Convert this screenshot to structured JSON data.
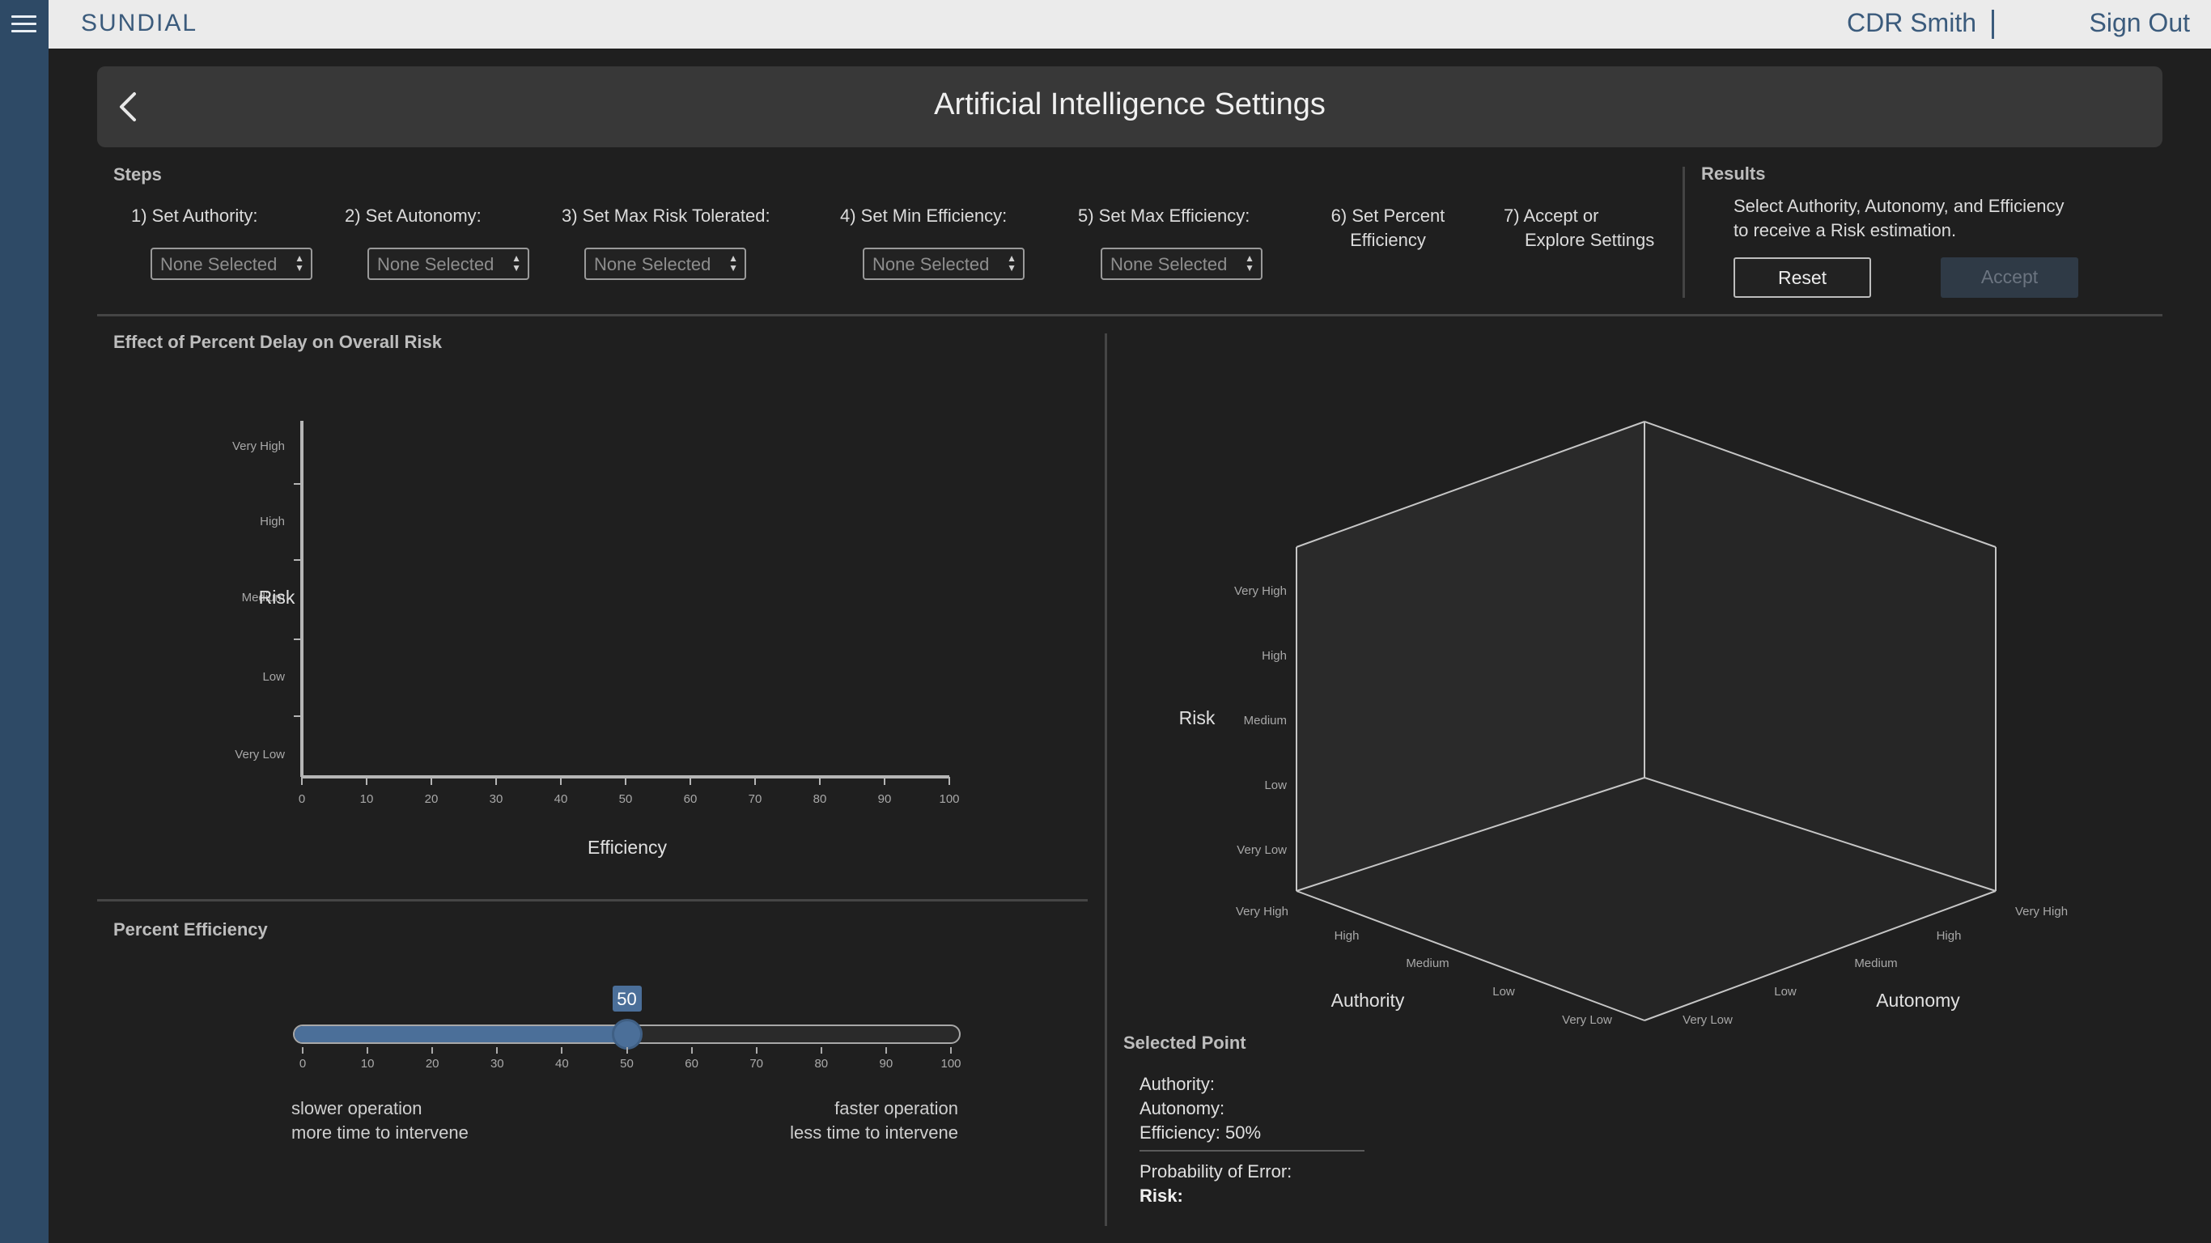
{
  "app": {
    "brand": "SUNDIAL",
    "user": "CDR Smith",
    "signout": "Sign Out",
    "title": "Artificial Intelligence Settings"
  },
  "steps": {
    "label": "Steps",
    "items": [
      {
        "label": "1) Set Authority:",
        "value": "None Selected"
      },
      {
        "label": "2) Set Autonomy:",
        "value": "None Selected"
      },
      {
        "label": "3) Set Max Risk Tolerated:",
        "value": "None Selected"
      },
      {
        "label": "4) Set Min Efficiency:",
        "value": "None Selected"
      },
      {
        "label": "5) Set Max Efficiency:",
        "value": "None Selected"
      },
      {
        "line1": "6) Set Percent",
        "line2": "Efficiency"
      },
      {
        "line1": "7) Accept or",
        "line2": "Explore Settings"
      }
    ]
  },
  "results": {
    "label": "Results",
    "line1": "Select Authority, Autonomy, and Efficiency",
    "line2": "to receive a Risk estimation.",
    "reset": "Reset",
    "accept": "Accept"
  },
  "chart_data": [
    {
      "type": "line",
      "title": "Effect of Percent Delay on Overall Risk",
      "xlabel": "Efficiency",
      "ylabel": "Risk",
      "x_ticks": [
        "0",
        "10",
        "20",
        "30",
        "40",
        "50",
        "60",
        "70",
        "80",
        "90",
        "100"
      ],
      "y_ticks": [
        "Very Low",
        "Low",
        "Medium",
        "High",
        "Very High"
      ],
      "xlim": [
        0,
        100
      ],
      "series": []
    },
    {
      "type": "scatter",
      "title": "",
      "zlabel": "Risk",
      "xlabel": "Authority",
      "ylabel": "Autonomy",
      "z_ticks": [
        "Very Low",
        "Low",
        "Medium",
        "High",
        "Very High"
      ],
      "x_ticks": [
        "Very High",
        "High",
        "Medium",
        "Low",
        "Very Low"
      ],
      "y_ticks": [
        "Very Low",
        "Low",
        "Medium",
        "High",
        "Very High"
      ],
      "points": []
    }
  ],
  "percent_efficiency": {
    "title": "Percent Efficiency",
    "value": 50,
    "min": 0,
    "max": 100,
    "ticks": [
      "0",
      "10",
      "20",
      "30",
      "40",
      "50",
      "60",
      "70",
      "80",
      "90",
      "100"
    ],
    "slow_line1": "slower operation",
    "slow_line2": "more time to intervene",
    "fast_line1": "faster operation",
    "fast_line2": "less time to intervene"
  },
  "selected_point": {
    "title": "Selected Point",
    "authority": "Authority:",
    "autonomy": "Autonomy:",
    "efficiency": "Efficiency: 50%",
    "prob_error": "Probability of Error:",
    "risk": "Risk:"
  }
}
